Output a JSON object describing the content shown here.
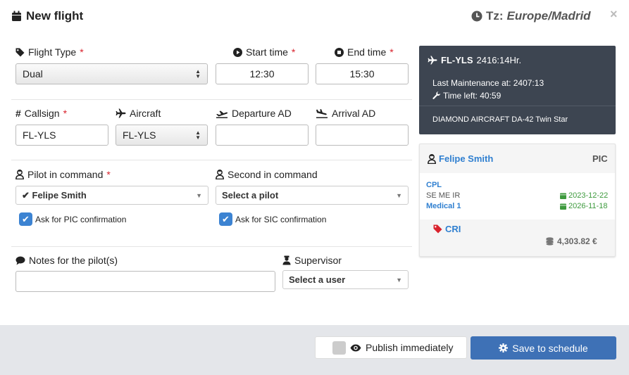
{
  "header": {
    "title": "New flight",
    "tz_label": "Tz:",
    "tz_value": "Europe/Madrid",
    "close": "×"
  },
  "form": {
    "flight_type": {
      "label": "Flight Type",
      "required": "*",
      "value": "Dual"
    },
    "start_time": {
      "label": "Start time",
      "required": "*",
      "value": "12:30"
    },
    "end_time": {
      "label": "End time",
      "required": "*",
      "value": "15:30"
    },
    "callsign": {
      "label": "Callsign",
      "required": "*",
      "value": "FL-YLS"
    },
    "aircraft": {
      "label": "Aircraft",
      "value": "FL-YLS"
    },
    "departure": {
      "label": "Departure AD",
      "value": ""
    },
    "arrival": {
      "label": "Arrival AD",
      "value": ""
    },
    "pic": {
      "label": "Pilot in command",
      "required": "*",
      "value": "✔ Felipe Smith",
      "confirm": "Ask for PIC confirmation"
    },
    "sic": {
      "label": "Second in command",
      "value": "Select a pilot",
      "confirm": "Ask for SIC confirmation"
    },
    "notes": {
      "label": "Notes for the pilot(s)",
      "value": ""
    },
    "supervisor": {
      "label": "Supervisor",
      "value": "Select a user"
    }
  },
  "aircraft_card": {
    "reg": "FL-YLS",
    "hours": "2416:14Hr.",
    "last_maintenance": "Last Maintenance at: 2407:13",
    "time_left": "Time left: 40:59",
    "model": "DIAMOND AIRCRAFT DA-42 Twin Star"
  },
  "pilot_card": {
    "name": "Felipe Smith",
    "role": "PIC",
    "license": "CPL",
    "ratings": "SE ME IR",
    "license_date": "2023-12-22",
    "medical": "Medical 1",
    "medical_date": "2026-11-18",
    "tag": "CRI",
    "balance": "4,303.82 €"
  },
  "footer": {
    "publish": "Publish immediately",
    "save": "Save to schedule"
  },
  "colors": {
    "accent": "#3e71b6",
    "required": "#d9232d",
    "link": "#2f7fd0",
    "ok": "#3d9a3d"
  }
}
